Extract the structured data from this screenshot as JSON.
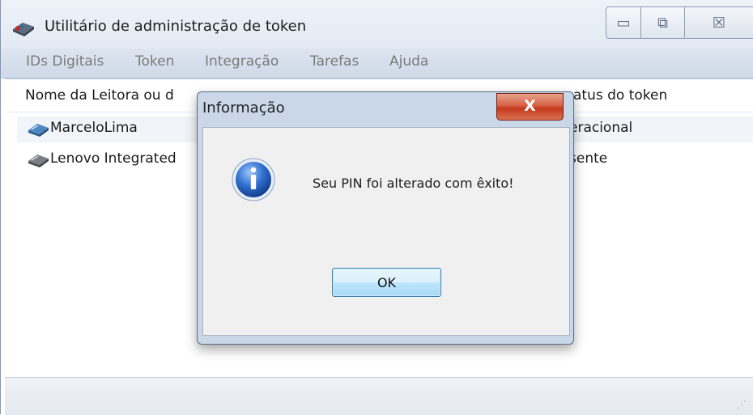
{
  "window": {
    "title": "Utilitário de administração de token",
    "controls": {
      "minimize": "▭",
      "maximize": "⧉",
      "close": "☒"
    }
  },
  "menu": [
    "IDs Digitais",
    "Token",
    "Integração",
    "Tarefas",
    "Ajuda"
  ],
  "list": {
    "columns": [
      "Nome da Leitora ou d",
      "atus do token"
    ],
    "rows": [
      {
        "name": "MarceloLima",
        "status": "eracional",
        "selected": true
      },
      {
        "name": "Lenovo Integrated",
        "status": "sente",
        "selected": false
      }
    ]
  },
  "dialog": {
    "title": "Informação",
    "close_glyph": "X",
    "message": "Seu PIN foi alterado com êxito!",
    "ok_label": "OK"
  },
  "statusbar": {
    "grip": "⋰"
  },
  "colors": {
    "titlebar": "#e6edf5",
    "menubar": "#d4deeb",
    "dialog_frame": "#c9d7e8",
    "close_red": "#c5391d",
    "ok_border": "#3c7fb1"
  }
}
